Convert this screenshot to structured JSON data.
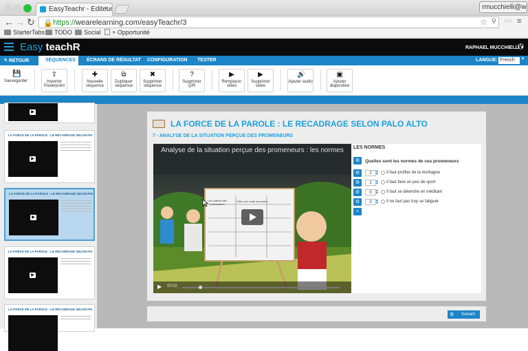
{
  "browser": {
    "tab_title": "EasyTeachr - Editeur de r...",
    "tab_close": "×",
    "url_host": "https://",
    "url_rest": "wearelearning.com/easyTeachr/3",
    "profile": "rmucchielli@we...",
    "bookmarks": [
      "StarterTabs",
      "TODO",
      "Social",
      "+ Opportunité"
    ]
  },
  "app": {
    "brand_easy": "Easy",
    "brand_teach": "teach",
    "brand_r": "R",
    "user_name": "RAPHAEL MUCCHIELLI",
    "user_caret": "▾"
  },
  "nav": {
    "back": "RETOUR",
    "items": [
      "SÉQUENCES",
      "ÉCRANS DE RÉSULTAT",
      "CONFIGURATION",
      "TESTER"
    ],
    "language_label": "LANGUE:",
    "language_value": "French"
  },
  "ribbon": {
    "buttons": [
      {
        "label": "Sauvegarder",
        "icon": "💾"
      },
      {
        "label": "Importer Powerpoint",
        "icon": "⇪"
      },
      {
        "label": "Nouvelle séquence",
        "icon": "✚"
      },
      {
        "label": "Dupliquer séquence",
        "icon": "⧉"
      },
      {
        "label": "Supprimer séquence",
        "icon": "✖"
      },
      {
        "label": "Supprimer Q/R",
        "icon": "?"
      },
      {
        "label": "Remplacer vidéo",
        "icon": "▶"
      },
      {
        "label": "Supprimer vidéo",
        "icon": "▶"
      },
      {
        "label": "Ajouter audio",
        "icon": "🔊"
      },
      {
        "label": "Ajouter diapositive",
        "icon": "▣"
      }
    ]
  },
  "sidebar": {
    "slide_title": "LA FORCE DE LA PAROLE : LE RECADRAGE SELON PALO ALTO"
  },
  "content": {
    "title": "LA FORCE DE LA PAROLE : LE RECADRAGE SELON PALO ALTO",
    "subtitle": "7 - ANALYSE DE LA SITUATION PERÇUE DES PROMENEURS",
    "video_title": "Analyse de la situation perçue des promeneurs : les normes",
    "video_time": "00:02",
    "whiteboard_col1": "Les valeurs des promeneurs",
    "whiteboard_col2": "Faire une vraie excursion",
    "normes_header": "LES NORMES",
    "question": "Quelles sont les normes de ces promeneurs",
    "answers": [
      {
        "score": "2",
        "text": "Il faut profiter de la montagne"
      },
      {
        "score": "2",
        "text": "Il faut faire un peu de sport"
      },
      {
        "score": "0",
        "text": "Il faut se détendre en méditant"
      },
      {
        "score": "0",
        "text": "Il ne faut pas trop se fatiguer"
      }
    ],
    "next_button": "Suivant"
  }
}
